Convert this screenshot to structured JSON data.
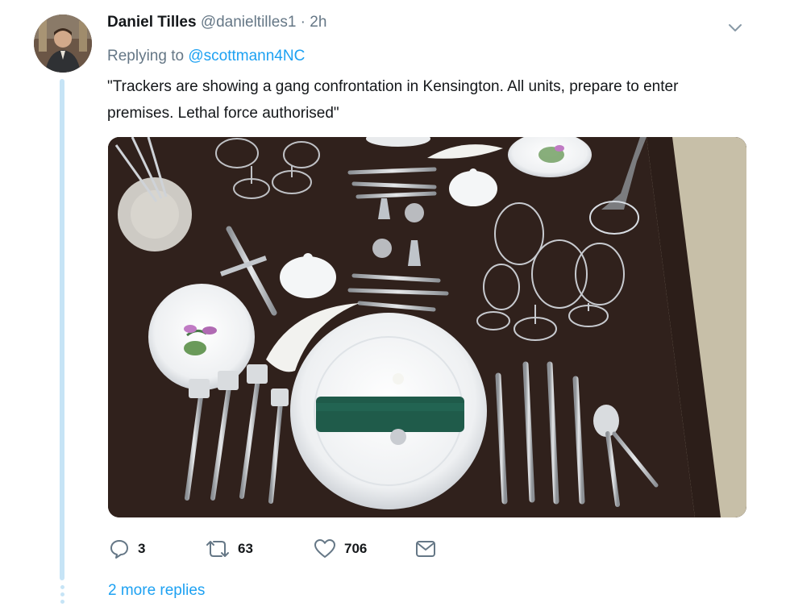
{
  "tweet": {
    "author_name": "Daniel Tilles",
    "author_handle": "@danieltilles1",
    "separator": "·",
    "time": "2h",
    "replying_prefix": "Replying to",
    "replying_to": "@scottmann4NC",
    "text": "\"Trackers are showing a gang confrontation in Kensington. All units, prepare to enter premises. Lethal force authorised\""
  },
  "actions": {
    "replies": "3",
    "retweets": "63",
    "likes": "706"
  },
  "more_replies": "2 more replies",
  "icons": {
    "reply": "reply-icon",
    "retweet": "retweet-icon",
    "like": "heart-icon",
    "message": "envelope-icon",
    "menu": "chevron-down-icon"
  },
  "colors": {
    "link": "#1da1f2",
    "muted": "#657786",
    "thread_line": "#c6e4f6"
  }
}
